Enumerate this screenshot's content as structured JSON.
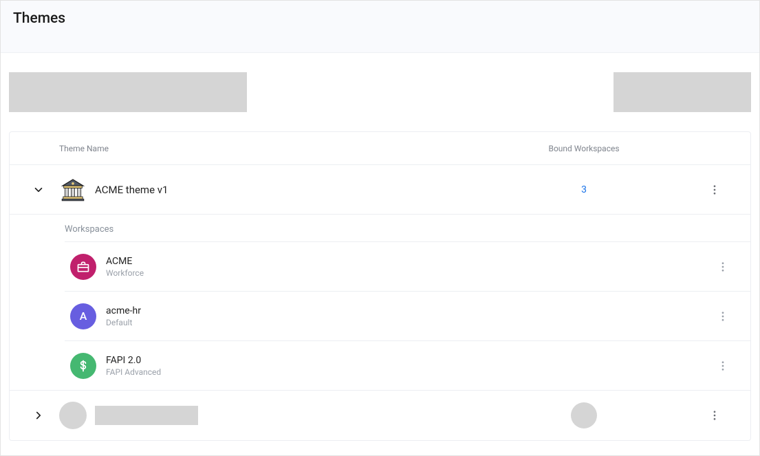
{
  "header": {
    "title": "Themes"
  },
  "columns": {
    "theme_name": "Theme Name",
    "bound_workspaces": "Bound Workspaces"
  },
  "theme_expanded": {
    "name": "ACME theme v1",
    "bound_count": "3",
    "workspaces_label": "Workspaces",
    "workspaces": [
      {
        "name": "ACME",
        "type": "Workforce",
        "avatar_letter": "",
        "avatar_icon": "briefcase",
        "avatar_color": "#c0206c"
      },
      {
        "name": "acme-hr",
        "type": "Default",
        "avatar_letter": "A",
        "avatar_icon": "",
        "avatar_color": "#675ee0"
      },
      {
        "name": "FAPI 2.0",
        "type": "FAPI Advanced",
        "avatar_letter": "$",
        "avatar_icon": "dollar",
        "avatar_color": "#45b871"
      }
    ]
  }
}
